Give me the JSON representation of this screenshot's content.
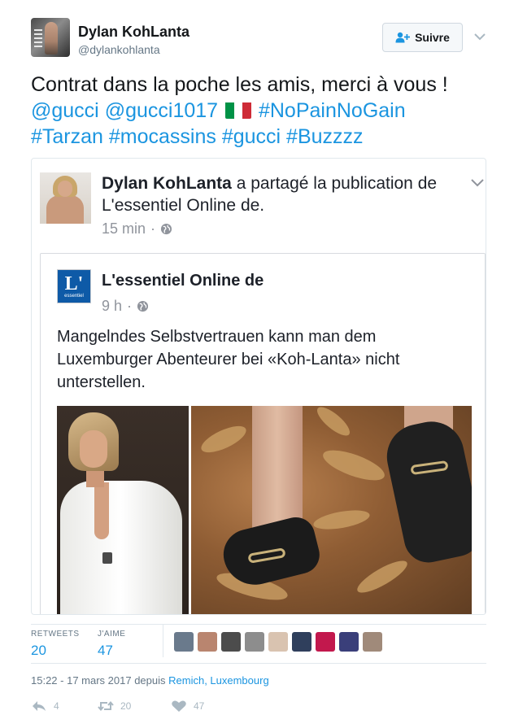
{
  "author": {
    "name": "Dylan KohLanta",
    "handle": "@dylankohlanta",
    "follow_label": "Suivre"
  },
  "tweet": {
    "line1": "Contrat dans la poche les amis, merci à vous !",
    "mention1": "@gucci",
    "mention2": "@gucci1017",
    "flag_colors": [
      "#009246",
      "#ffffff",
      "#ce2b37"
    ],
    "hashtags_line2": "#NoPainNoGain",
    "hashtags_line3": "#Tarzan #mocassins #gucci #Buzzzz"
  },
  "shared": {
    "sharer": "Dylan KohLanta",
    "action_text": "a partagé la publication de L'essentiel Online de.",
    "time": "15 min",
    "page": {
      "logo_letter": "L'",
      "logo_word": "essentiel",
      "name": "L'essentiel Online de",
      "time": "9 h",
      "text": "Mangelndes Selbstvertrauen kann man dem Luxemburger Abenteurer bei «Koh-Lanta» nicht unterstellen."
    }
  },
  "stats": {
    "retweets_label": "RETWEETS",
    "retweets": "20",
    "likes_label": "J'AIME",
    "likes": "47",
    "liker_colors": [
      "#6a7a8c",
      "#b9856f",
      "#4c4c4c",
      "#8d8d8d",
      "#d9c3b0",
      "#2f3f5c",
      "#c2184d",
      "#3a3f7a",
      "#a08a7a"
    ]
  },
  "meta": {
    "timestamp": "15:22 - 17 mars 2017 depuis",
    "location": "Remich, Luxembourg"
  },
  "actions": {
    "reply_count": "4",
    "retweet_count": "20",
    "like_count": "47"
  },
  "colors": {
    "link": "#1b95e0",
    "muted": "#657786",
    "logo_blue": "#0e5aa7"
  }
}
